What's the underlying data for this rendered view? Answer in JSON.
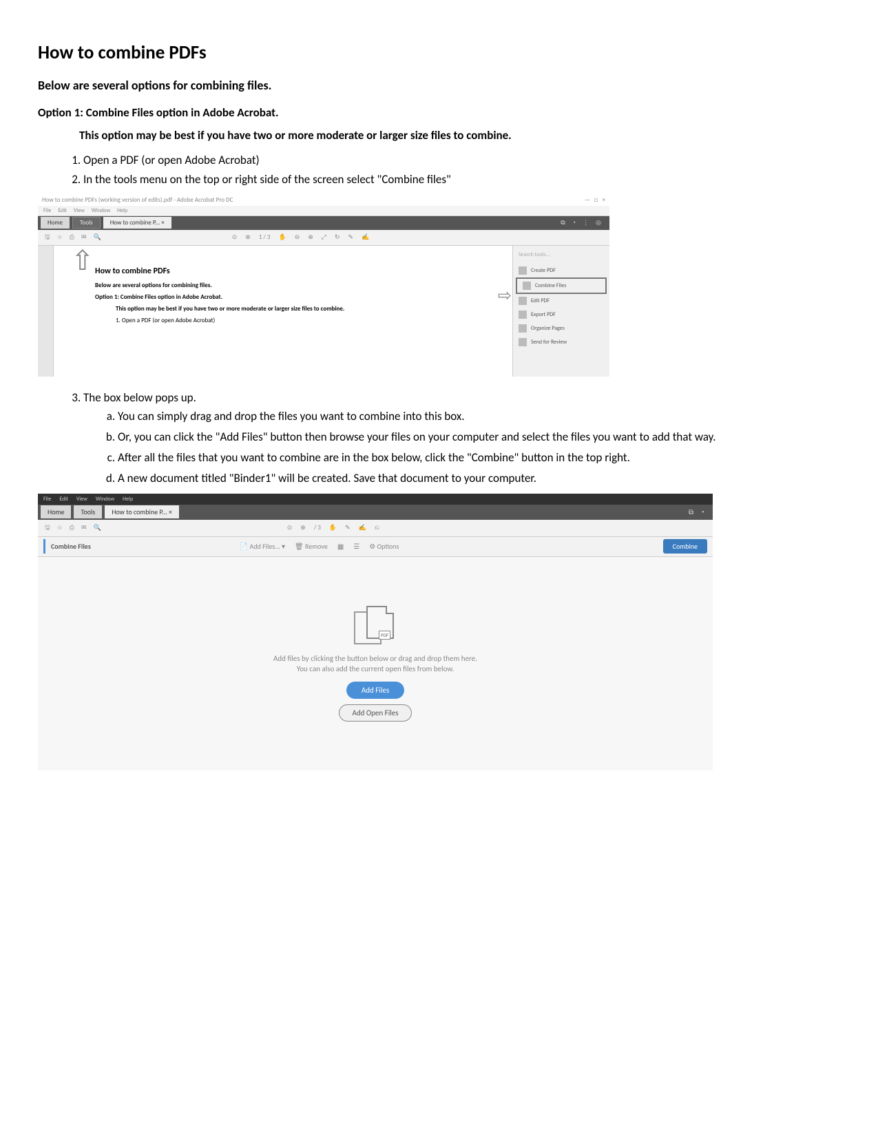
{
  "title": "How to combine PDFs",
  "intro": "Below are several options for combining files.",
  "option1_heading": "Option 1: Combine Files option in Adobe Acrobat.",
  "option1_note": "This option may be best if you have two or more moderate or larger size files to combine.",
  "steps12": [
    "Open a PDF (or open Adobe Acrobat)",
    "In the tools menu on the top or right side of the screen select \"Combine files\""
  ],
  "step3": "The box below pops up.",
  "step3_sub": [
    "You can simply drag and drop the files you want to combine into this box.",
    "Or, you can click the \"Add Files\" button then browse your files on your computer and select the files you want to add that way.",
    "After all the files that you want to combine are in the box below, click the \"Combine\" button in the top right.",
    "A new document titled \"Binder1\" will be created. Save that document to your computer."
  ],
  "shot1": {
    "win_title": "How to combine PDFs (working version of edits).pdf - Adobe Acrobat Pro DC",
    "menu": [
      "File",
      "Edit",
      "View",
      "Window",
      "Help"
    ],
    "tabs": {
      "home": "Home",
      "tools": "Tools",
      "doc": "How to combine P... ×"
    },
    "page_hint": "1 / 3",
    "side_search": "Search tools...",
    "side_items": [
      "Create PDF",
      "Combine Files",
      "Edit PDF",
      "Export PDF",
      "Organize Pages",
      "Send for Review"
    ],
    "doc_h": "How to combine PDFs",
    "doc_p1": "Below are several options for combining files.",
    "doc_p2": "Option 1: Combine Files option in Adobe Acrobat.",
    "doc_p3": "This option may be best if you have two or more moderate or larger size files to combine.",
    "doc_li1": "1.    Open a PDF (or open Adobe Acrobat)"
  },
  "shot2": {
    "menu": [
      "File",
      "Edit",
      "View",
      "Window",
      "Help"
    ],
    "tabs": {
      "home": "Home",
      "tools": "Tools",
      "doc": "How to combine P... ×"
    },
    "page_hint": "/ 3",
    "cf_label": "Combine Files",
    "cf_add": "Add Files... ▾",
    "cf_remove": "Remove",
    "cf_options": "Options",
    "combine_btn": "Combine",
    "drop_line1": "Add files by clicking the button below or drag and drop them here.",
    "drop_line2": "You can also add the current open files from below.",
    "add_files_btn": "Add Files",
    "add_open_btn": "Add Open Files",
    "pdf_badge": "PDF"
  }
}
